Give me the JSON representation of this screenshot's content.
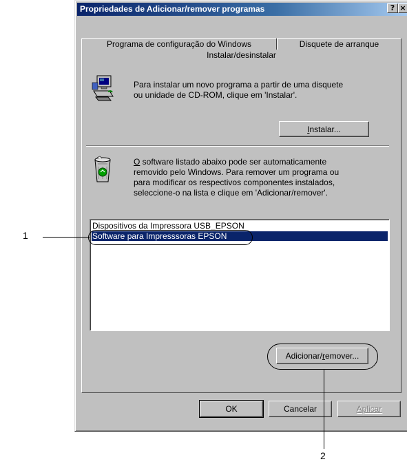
{
  "window": {
    "title": "Propriedades de Adicionar/remover programas",
    "help_button": "?",
    "close_button": "×"
  },
  "tabs": {
    "tab1": "Programa de configuração do Windows",
    "tab2": "Disquete de arranque",
    "active": "Instalar/desinstalar"
  },
  "install": {
    "line1": "Para instalar um novo programa a partir de uma disquete",
    "line2": "ou unidade de CD-ROM, clique em 'Instalar'.",
    "button_rest": "nstalar...",
    "button_mnemonic": "I"
  },
  "remove": {
    "mnemonic": "O",
    "line1_rest": " software listado abaixo pode ser automaticamente",
    "line2": "removido pelo Windows. Para remover um programa ou",
    "line3": "para modificar os respectivos componentes instalados,",
    "line4": "seleccione-o na lista e clique em 'Adicionar/remover'."
  },
  "programs": [
    {
      "name": "Dispositivos da Impressora USB_EPSON",
      "selected": false
    },
    {
      "name": "Software para Impresssoras EPSON",
      "selected": true
    }
  ],
  "add_remove_button": {
    "before": "Adicionar/",
    "mnemonic": "r",
    "after": "emover..."
  },
  "footer": {
    "ok": "OK",
    "cancel": "Cancelar",
    "apply": "Aplicar"
  },
  "callouts": {
    "one": "1",
    "two": "2"
  },
  "colors": {
    "title_bar": "#0a246a",
    "selection": "#0a246a",
    "face": "#c0c0c0"
  }
}
